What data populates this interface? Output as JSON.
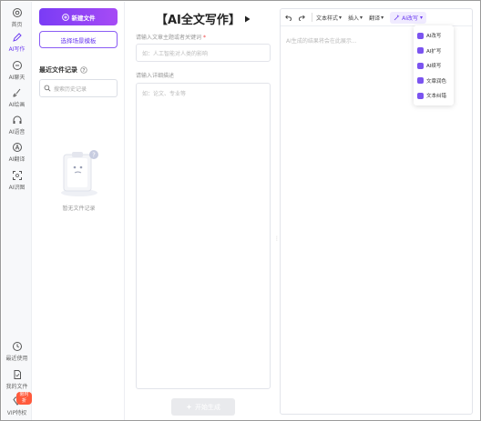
{
  "rail": {
    "items": [
      {
        "label": "首页",
        "icon": "home-icon"
      },
      {
        "label": "AI写作",
        "icon": "pen-icon",
        "active": true
      },
      {
        "label": "AI聊天",
        "icon": "chat-icon"
      },
      {
        "label": "AI绘画",
        "icon": "brush-icon"
      },
      {
        "label": "AI语音",
        "icon": "headphones-icon"
      },
      {
        "label": "AI翻译",
        "icon": "translate-icon"
      },
      {
        "label": "AI识图",
        "icon": "scan-icon"
      }
    ],
    "bottom": [
      {
        "label": "最近使用",
        "icon": "clock-icon"
      },
      {
        "label": "我的文件",
        "icon": "file-icon"
      },
      {
        "label": "VIP特权",
        "icon": "diamond-icon",
        "badge": "限时折"
      }
    ]
  },
  "history": {
    "new_label": "新建文件",
    "template_label": "选择场景模板",
    "recent_title": "最近文件记录",
    "search_placeholder": "搜索历史记录",
    "empty_text": "暂无文件记录"
  },
  "main": {
    "title": "【AI全文写作】",
    "topic_label": "请输入文章主题或者关键词",
    "topic_required": "*",
    "topic_placeholder": "如：人工智能对人类的影响",
    "desc_label": "请输入详细描述",
    "desc_placeholder": "如：论文、专业等",
    "generate_label": "开始生成"
  },
  "editor": {
    "toolbar": {
      "text_style": "文本样式",
      "insert": "插入",
      "translate": "翻译",
      "ai_rewrite": "AI改写"
    },
    "placeholder": "AI生成的结果将会在此展示..."
  },
  "dropdown": {
    "items": [
      "AI改写",
      "AI扩写",
      "AI续写",
      "文章润色",
      "文本纠错"
    ]
  },
  "colors": {
    "accent": "#6c3cf0",
    "accent_gradient_end": "#a64bf5",
    "required": "#f04040",
    "badge": "#ff5a3c"
  }
}
